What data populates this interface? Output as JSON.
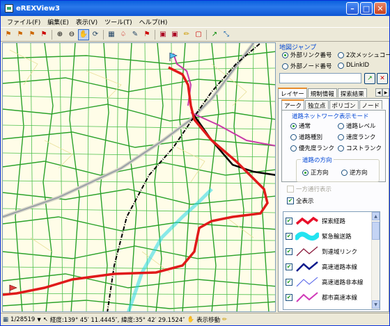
{
  "title": "eREXView3",
  "menu": [
    "ファイル(F)",
    "編集(E)",
    "表示(V)",
    "ツール(T)",
    "ヘルプ(H)"
  ],
  "jump": {
    "title": "地図ジャンプ",
    "options": [
      "外部リンク番号",
      "2次メッシュコード",
      "外部ノード番号",
      "DLinkID"
    ],
    "selected": "外部リンク番号",
    "input_value": ""
  },
  "tabs": [
    "レイヤー",
    "規制情報",
    "探索結果"
  ],
  "subtabs": [
    "アーク",
    "独立点",
    "ポリゴン",
    "ノード"
  ],
  "road_mode": {
    "title": "道路ネットワーク表示モード",
    "options": [
      "通常",
      "道路レベル",
      "道路種別",
      "速度ランク",
      "優先度ランク",
      "コストランク"
    ],
    "selected": "通常"
  },
  "direction": {
    "title": "道路の方向",
    "options": [
      "正方向",
      "逆方向"
    ],
    "selected": "正方向"
  },
  "oneway_label": "一方通行表示",
  "show_all_label": "全表示",
  "layers": [
    {
      "label": "探索経路",
      "color": "#e8102a",
      "style": "thick-wave"
    },
    {
      "label": "緊急輸送路",
      "color": "#23e3f0",
      "style": "blob"
    },
    {
      "label": "到達域リンク",
      "color": "#8a1a3c",
      "style": "thin"
    },
    {
      "label": "高速道路本線",
      "color": "#0a1a8c",
      "style": "medium"
    },
    {
      "label": "高速道路非本線",
      "color": "#4a5ae8",
      "style": "thin"
    },
    {
      "label": "都市高速本線",
      "color": "#d03ab8",
      "style": "medium"
    }
  ],
  "status": {
    "scale": "1/28519",
    "coords": "経度:139° 45′ 11.4445″, 緯度:35° 42′ 29.1524″",
    "mode": "表示移動"
  }
}
